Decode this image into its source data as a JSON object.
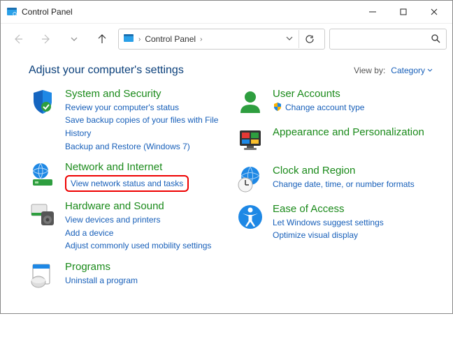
{
  "window": {
    "title": "Control Panel"
  },
  "address": {
    "root": "Control Panel"
  },
  "header": {
    "title": "Adjust your computer's settings",
    "viewby_label": "View by:",
    "viewby_value": "Category"
  },
  "left": [
    {
      "name": "System and Security",
      "links": [
        "Review your computer's status",
        "Save backup copies of your files with File History",
        "Backup and Restore (Windows 7)"
      ]
    },
    {
      "name": "Network and Internet",
      "links": [
        "View network status and tasks"
      ],
      "highlight": 0
    },
    {
      "name": "Hardware and Sound",
      "links": [
        "View devices and printers",
        "Add a device",
        "Adjust commonly used mobility settings"
      ]
    },
    {
      "name": "Programs",
      "links": [
        "Uninstall a program"
      ]
    }
  ],
  "right": [
    {
      "name": "User Accounts",
      "links": [
        "Change account type"
      ],
      "shield": 0
    },
    {
      "name": "Appearance and Personalization",
      "links": []
    },
    {
      "name": "Clock and Region",
      "links": [
        "Change date, time, or number formats"
      ]
    },
    {
      "name": "Ease of Access",
      "links": [
        "Let Windows suggest settings",
        "Optimize visual display"
      ]
    }
  ]
}
